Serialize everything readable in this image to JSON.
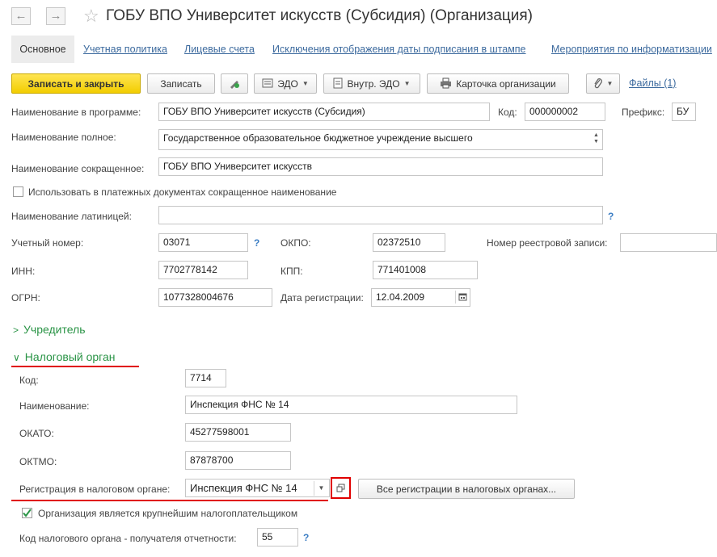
{
  "window": {
    "title": "ГОБУ ВПО Университет искусств (Субсидия) (Организация)",
    "back_glyph": "←",
    "forward_glyph": "→",
    "star_glyph": "☆"
  },
  "tabs": [
    {
      "label": "Основное",
      "active": true
    },
    {
      "label": "Учетная политика"
    },
    {
      "label": "Лицевые счета"
    },
    {
      "label": "Исключения отображения даты подписания в штампе"
    },
    {
      "label": "Мероприятия по информатизации"
    }
  ],
  "toolbar": {
    "save_close": "Записать и закрыть",
    "save": "Записать",
    "edo": "ЭДО",
    "internal_edo": "Внутр. ЭДО",
    "org_card": "Карточка организации",
    "files": "Файлы (1)"
  },
  "fields": {
    "name_program_label": "Наименование в программе:",
    "name_program_value": "ГОБУ ВПО Университет искусств (Субсидия)",
    "code_label": "Код:",
    "code_value": "000000002",
    "prefix_label": "Префикс:",
    "prefix_value": "БУ",
    "name_full_label": "Наименование полное:",
    "name_full_value": "Государственное образовательное бюджетное учреждение высшего",
    "name_short_label": "Наименование сокращенное:",
    "name_short_value": "ГОБУ ВПО Университет искусств",
    "use_short_label": "Использовать в платежных документах сокращенное наименование",
    "use_short_checked": false,
    "name_latin_label": "Наименование латиницей:",
    "name_latin_value": "",
    "reg_number_label": "Учетный номер:",
    "reg_number_value": "03071",
    "okpo_label": "ОКПО:",
    "okpo_value": "02372510",
    "registry_label": "Номер реестровой записи:",
    "registry_value": "",
    "inn_label": "ИНН:",
    "inn_value": "7702778142",
    "kpp_label": "КПП:",
    "kpp_value": "771401008",
    "ogrn_label": "ОГРН:",
    "ogrn_value": "1077328004676",
    "reg_date_label": "Дата регистрации:",
    "reg_date_value": "12.04.2009",
    "help_glyph": "?"
  },
  "sections": {
    "founder": "Учредитель",
    "tax_authority": "Налоговый орган"
  },
  "tax": {
    "code_label": "Код:",
    "code_value": "7714",
    "name_label": "Наименование:",
    "name_value": "Инспекция ФНС № 14",
    "okato_label": "ОКАТО:",
    "okato_value": "45277598001",
    "oktmo_label": "ОКТМО:",
    "oktmo_value": "87878700",
    "registration_label": "Регистрация в налоговом органе:",
    "registration_value": "Инспекция ФНС № 14",
    "all_registrations": "Все регистрации в налоговых органах...",
    "largest_taxpayer_label": "Организация является крупнейшим налогоплательщиком",
    "largest_taxpayer_checked": true,
    "recipient_code_label": "Код налогового органа - получателя отчетности:",
    "recipient_code_value": "55"
  },
  "colors": {
    "link": "#3c6a9e",
    "section": "#2a9446",
    "primary_button": "#f2cd00",
    "highlight": "#e00000"
  }
}
